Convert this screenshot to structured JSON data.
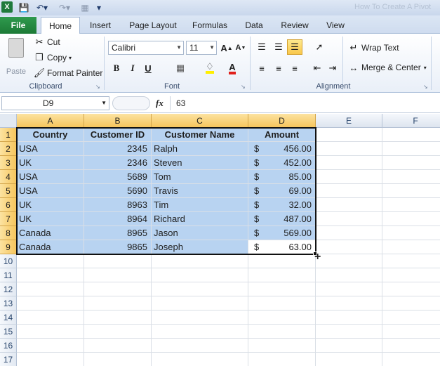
{
  "title_bar": {
    "app_icon": "X",
    "title": "How To Create A Pivot"
  },
  "tabs": [
    "File",
    "Home",
    "Insert",
    "Page Layout",
    "Formulas",
    "Data",
    "Review",
    "View"
  ],
  "active_tab": "Home",
  "clipboard": {
    "paste": "Paste",
    "cut": "Cut",
    "copy": "Copy",
    "format_painter": "Format Painter",
    "label": "Clipboard"
  },
  "font": {
    "name": "Calibri",
    "size": "11",
    "bold": "B",
    "italic": "I",
    "underline": "U",
    "label": "Font"
  },
  "alignment": {
    "wrap_text": "Wrap Text",
    "merge_center": "Merge & Center",
    "label": "Alignment"
  },
  "formula_bar": {
    "name_box": "D9",
    "fx": "fx",
    "value": "63"
  },
  "columns": [
    "A",
    "B",
    "C",
    "D",
    "E",
    "F"
  ],
  "rows": [
    "1",
    "2",
    "3",
    "4",
    "5",
    "6",
    "7",
    "8",
    "9",
    "10",
    "11",
    "12",
    "13",
    "14",
    "15",
    "16",
    "17"
  ],
  "headers": [
    "Country",
    "Customer ID",
    "Customer Name",
    "Amount"
  ],
  "data": [
    {
      "country": "USA",
      "id": "2345",
      "name": "Ralph",
      "cur": "$",
      "amount": "456.00"
    },
    {
      "country": "UK",
      "id": "2346",
      "name": "Steven",
      "cur": "$",
      "amount": "452.00"
    },
    {
      "country": "USA",
      "id": "5689",
      "name": "Tom",
      "cur": "$",
      "amount": "85.00"
    },
    {
      "country": "USA",
      "id": "5690",
      "name": "Travis",
      "cur": "$",
      "amount": "69.00"
    },
    {
      "country": "UK",
      "id": "8963",
      "name": "Tim",
      "cur": "$",
      "amount": "32.00"
    },
    {
      "country": "UK",
      "id": "8964",
      "name": "Richard",
      "cur": "$",
      "amount": "487.00"
    },
    {
      "country": "Canada",
      "id": "8965",
      "name": "Jason",
      "cur": "$",
      "amount": "569.00"
    },
    {
      "country": "Canada",
      "id": "9865",
      "name": "Joseph",
      "cur": "$",
      "amount": "63.00"
    }
  ]
}
